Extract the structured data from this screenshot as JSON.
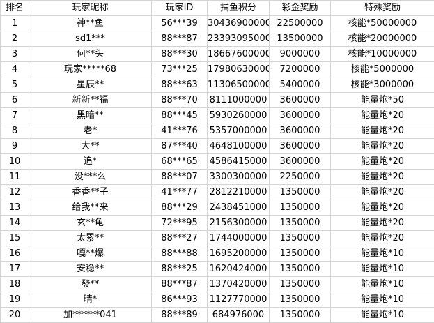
{
  "headers": [
    "排名",
    "玩家昵称",
    "玩家ID",
    "捕鱼积分",
    "彩金奖励",
    "特殊奖励"
  ],
  "rows": [
    [
      "1",
      "神**鱼",
      "56***39",
      "30436900000",
      "22500000",
      "核能*50000000"
    ],
    [
      "2",
      "sd1***",
      "88***87",
      "23393095000",
      "13500000",
      "核能*20000000"
    ],
    [
      "3",
      "何**头",
      "88***30",
      "18667600000",
      "9000000",
      "核能*10000000"
    ],
    [
      "4",
      "玩家*****68",
      "73***25",
      "17980630000",
      "7200000",
      "核能*5000000"
    ],
    [
      "5",
      "星辰**",
      "88***63",
      "11306500000",
      "5400000",
      "核能*3000000"
    ],
    [
      "6",
      "新新**福",
      "88***70",
      "8111000000",
      "3600000",
      "能量炮*50"
    ],
    [
      "7",
      "黑暗**",
      "88***45",
      "5930260000",
      "3600000",
      "能量炮*20"
    ],
    [
      "8",
      "老*",
      "41***76",
      "5357000000",
      "3600000",
      "能量炮*20"
    ],
    [
      "9",
      "大**",
      "87***40",
      "4648100000",
      "3600000",
      "能量炮*20"
    ],
    [
      "10",
      "追*",
      "68***65",
      "4586415000",
      "3600000",
      "能量炮*20"
    ],
    [
      "11",
      "没***么",
      "88***07",
      "3300300000",
      "2250000",
      "能量炮*20"
    ],
    [
      "12",
      "香香**子",
      "41***77",
      "2812210000",
      "1350000",
      "能量炮*20"
    ],
    [
      "13",
      "给我**来",
      "88***29",
      "2438451000",
      "1350000",
      "能量炮*20"
    ],
    [
      "14",
      "玄**龟",
      "72***95",
      "2156300000",
      "1350000",
      "能量炮*20"
    ],
    [
      "15",
      "太累**",
      "88***27",
      "1744000000",
      "1350000",
      "能量炮*20"
    ],
    [
      "16",
      "嘎**爆",
      "88***88",
      "1695200000",
      "1350000",
      "能量炮*10"
    ],
    [
      "17",
      "安稳**",
      "88***25",
      "1620424000",
      "1350000",
      "能量炮*10"
    ],
    [
      "18",
      "發**",
      "88***87",
      "1370420000",
      "1350000",
      "能量炮*10"
    ],
    [
      "19",
      "晴*",
      "86***93",
      "1127770000",
      "1350000",
      "能量炮*10"
    ],
    [
      "20",
      "加******041",
      "88***89",
      "684976000",
      "1350000",
      "能量炮*10"
    ]
  ]
}
